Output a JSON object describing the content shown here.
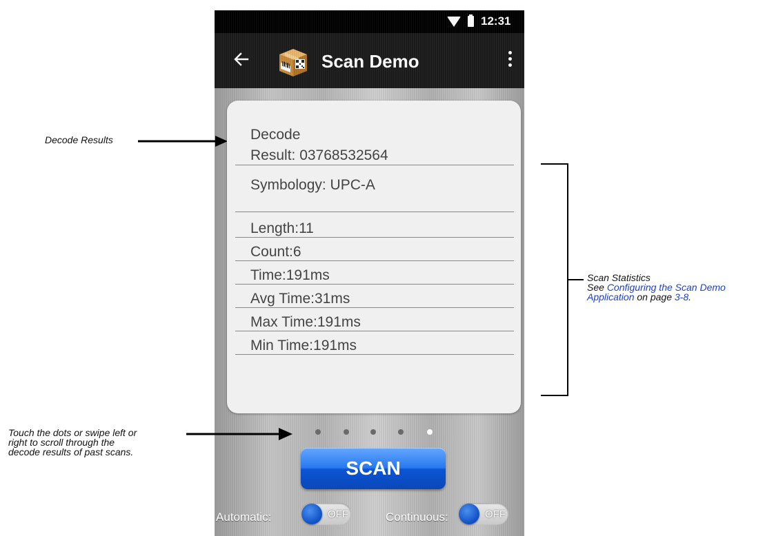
{
  "status_bar": {
    "time": "12:31"
  },
  "app_bar": {
    "title": "Scan Demo"
  },
  "result": {
    "decode_line1": "Decode",
    "decode_line2": "Result: 03768532564",
    "symbology": "Symbology: UPC-A",
    "stats": {
      "length": "Length:11",
      "count": "Count:6",
      "time": "Time:191ms",
      "avg_time": "Avg Time:31ms",
      "max_time": "Max Time:191ms",
      "min_time": "Min Time:191ms"
    }
  },
  "pager": {
    "dot_count": 5,
    "active_index": 4
  },
  "scan_button": {
    "label": "SCAN"
  },
  "toggles": {
    "automatic": {
      "label": "Automatic:",
      "state": "OFF"
    },
    "continuous": {
      "label": "Continuous:",
      "state": "OFF"
    }
  },
  "callouts": {
    "decode_results": "Decode Results",
    "scan_statistics": {
      "title": "Scan Statistics",
      "see": "See ",
      "link1": "Configuring the Scan Demo",
      "link2": "Application",
      "on_page": " on page ",
      "page_ref": "3-8",
      "period": "."
    },
    "pager_hint": {
      "line1": "Touch the dots or swipe left or",
      "line2": "right to scroll through the",
      "line3": "decode results of past scans."
    }
  },
  "colors": {
    "scan_button": "#1a66e6",
    "toggle_knob": "#1456cf",
    "link": "#1a3fd1"
  }
}
